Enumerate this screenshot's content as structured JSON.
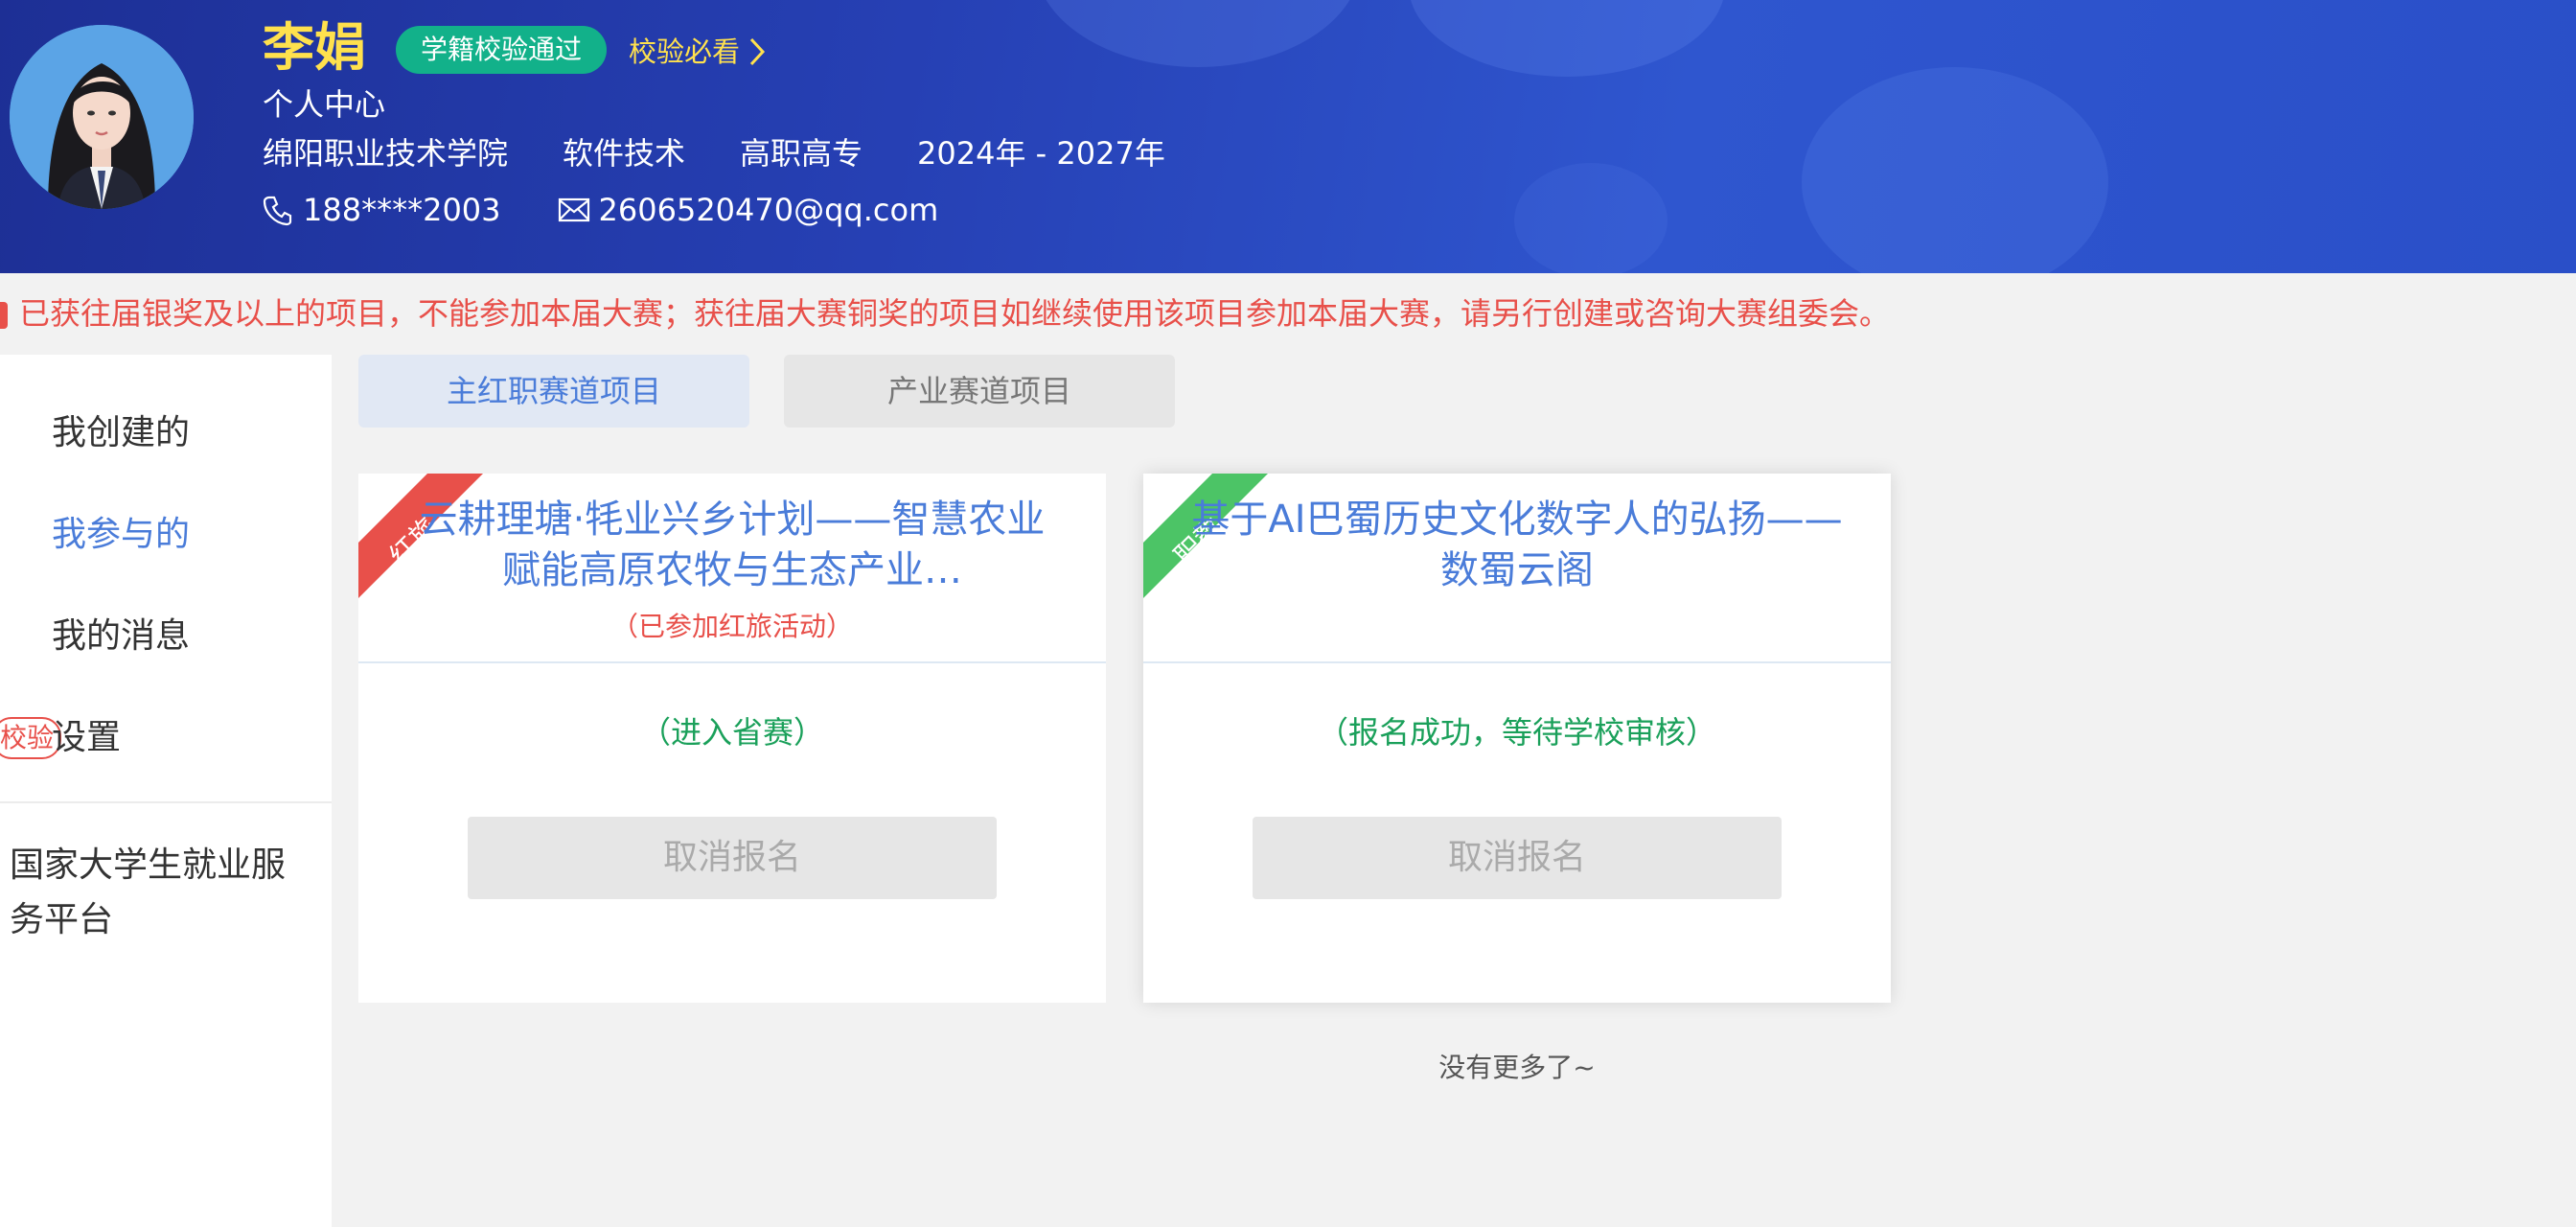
{
  "user": {
    "name": "李娟",
    "verify_badge": "学籍校验通过",
    "must_see": "校验必看",
    "subtitle": "个人中心",
    "school": "绵阳职业技术学院",
    "major": "软件技术",
    "level": "高职高专",
    "period": "2024年 - 2027年",
    "phone": "188****2003",
    "email": "2606520470@qq.com"
  },
  "notice": "已获往届银奖及以上的项目，不能参加本届大赛；获往届大赛铜奖的项目如继续使用该项目参加本届大赛，请另行创建或咨询大赛组委会。",
  "sidebar": {
    "items": [
      {
        "label": "我创建的"
      },
      {
        "label": "我参与的"
      },
      {
        "label": "我的消息"
      },
      {
        "label": "设置"
      }
    ],
    "settings_badge": "校验",
    "platform_link": "国家大学生就业服务平台"
  },
  "tabs": [
    {
      "label": "主红职赛道项目"
    },
    {
      "label": "产业赛道项目"
    }
  ],
  "cards": [
    {
      "corner": "红旅",
      "title": "云耕理塘·牦业兴乡计划——智慧农业赋能高原农牧与生态产业…",
      "note": "（已参加红旅活动）",
      "status": "（进入省赛）",
      "button": "取消报名"
    },
    {
      "corner": "职教",
      "title": "基于AI巴蜀历史文化数字人的弘扬——数蜀云阁",
      "status": "（报名成功，等待学校审核）",
      "button": "取消报名"
    }
  ],
  "footer": {
    "no_more": "没有更多了~"
  },
  "colors": {
    "accent": "#4a7cd9",
    "warning": "#e8504a",
    "success": "#1aa05a",
    "badge_green": "#12b18a",
    "name_yellow": "#ffe14d",
    "corner_red": "#e8504a",
    "corner_green": "#4cc466"
  },
  "icons": [
    "chevron-right-icon",
    "phone-icon",
    "mail-icon",
    "avatar"
  ]
}
